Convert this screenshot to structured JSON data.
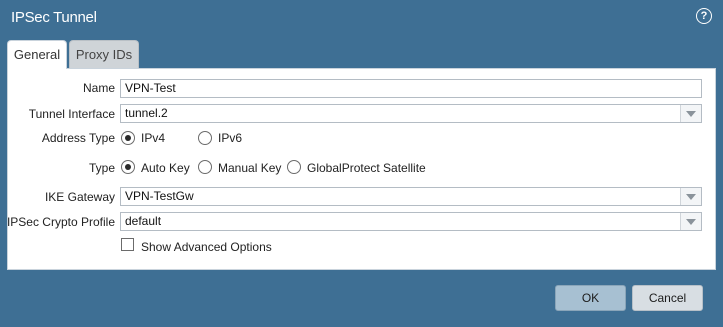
{
  "window": {
    "title": "IPSec Tunnel",
    "help_icon": "?"
  },
  "tabs": [
    {
      "label": "General",
      "active": true
    },
    {
      "label": "Proxy IDs",
      "active": false
    }
  ],
  "form": {
    "name": {
      "label": "Name",
      "value": "VPN-Test"
    },
    "tunnel_interface": {
      "label": "Tunnel Interface",
      "value": "tunnel.2"
    },
    "address_type": {
      "label": "Address Type",
      "options": [
        "IPv4",
        "IPv6"
      ],
      "selected": "IPv4"
    },
    "type": {
      "label": "Type",
      "options": [
        "Auto Key",
        "Manual Key",
        "GlobalProtect Satellite"
      ],
      "selected": "Auto Key"
    },
    "ike_gateway": {
      "label": "IKE Gateway",
      "value": "VPN-TestGw"
    },
    "ipsec_crypto_profile": {
      "label": "IPSec Crypto Profile",
      "value": "default"
    },
    "show_advanced": {
      "label": "Show Advanced Options",
      "checked": false
    }
  },
  "buttons": {
    "ok": "OK",
    "cancel": "Cancel"
  },
  "colors": {
    "window_bg": "#3e6f94",
    "ok_button": "#a7c0d2",
    "cancel_button": "#d8dee3"
  }
}
